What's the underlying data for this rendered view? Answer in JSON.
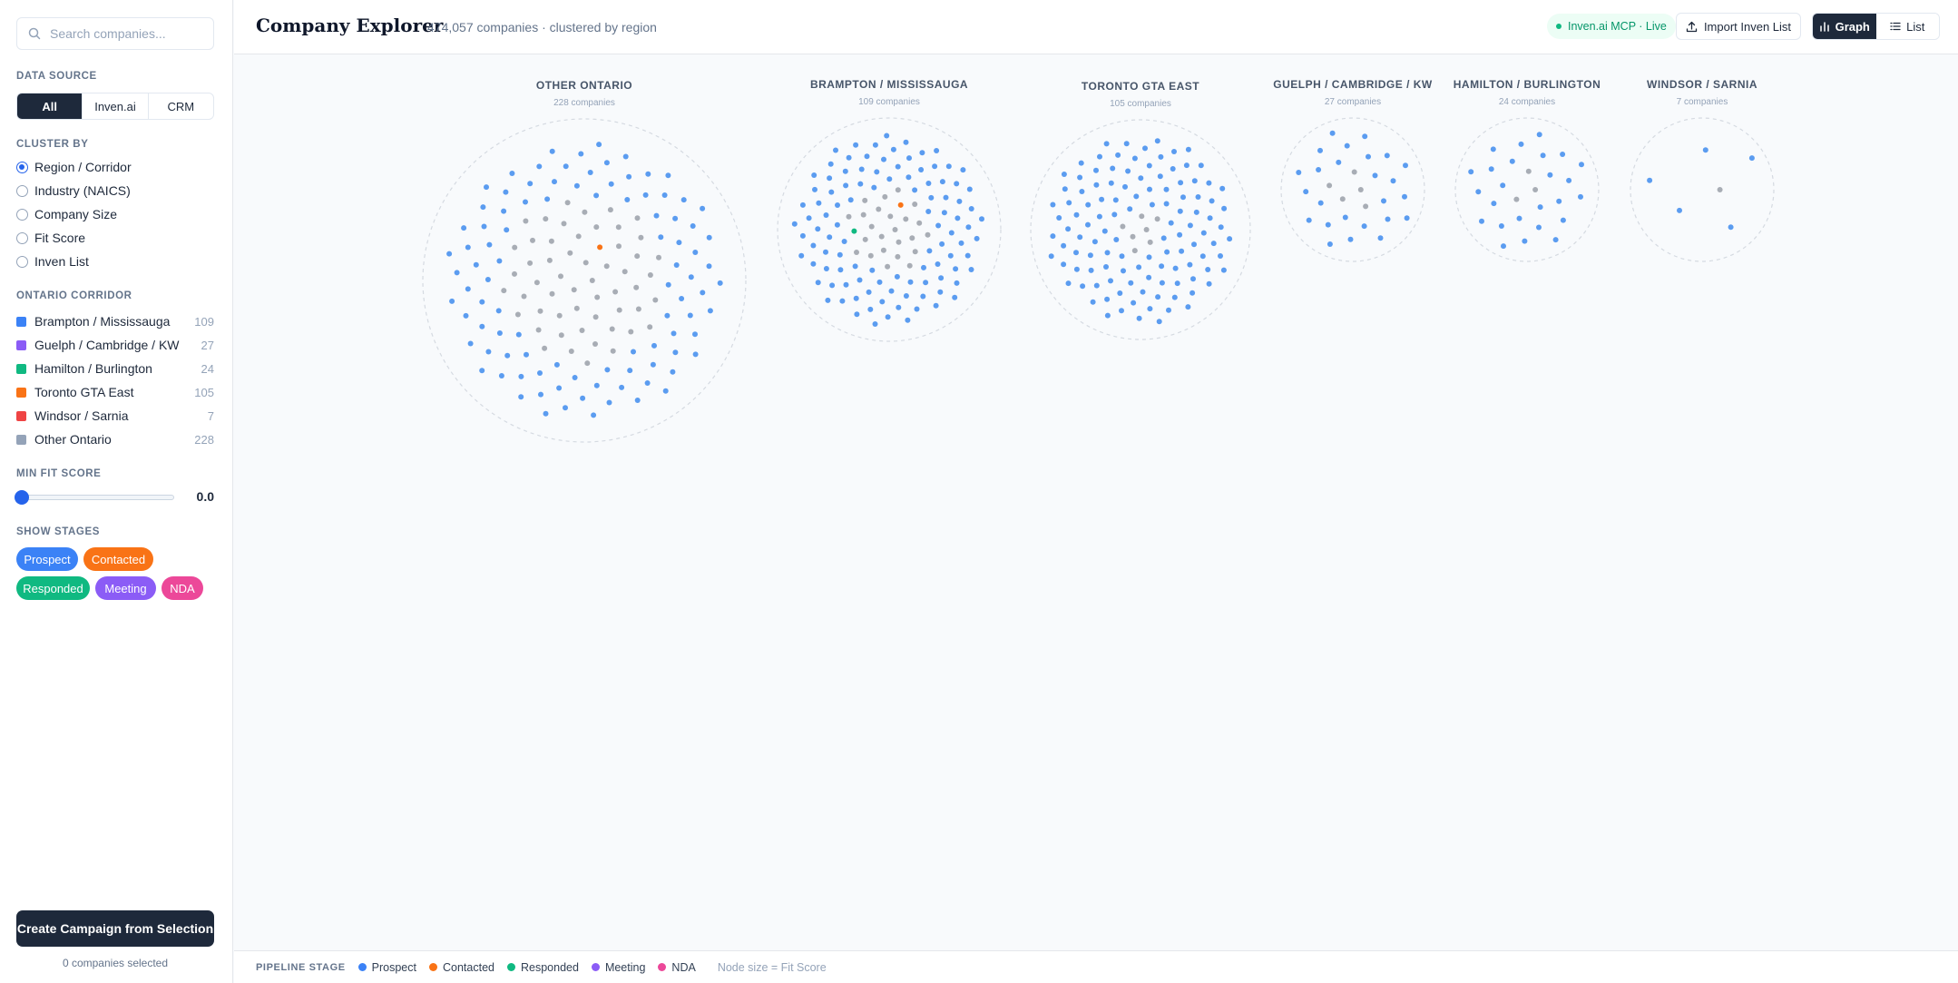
{
  "sidebar": {
    "search_placeholder": "Search companies...",
    "data_source": {
      "title": "DATA SOURCE",
      "options": [
        "All",
        "Inven.ai",
        "CRM"
      ],
      "selected": "All"
    },
    "cluster_by": {
      "title": "CLUSTER BY",
      "options": [
        "Region / Corridor",
        "Industry (NAICS)",
        "Company Size",
        "Fit Score",
        "Inven List"
      ],
      "selected": "Region / Corridor"
    },
    "corridor": {
      "title": "ONTARIO CORRIDOR",
      "items": [
        {
          "label": "Brampton / Mississauga",
          "count": "109",
          "color": "#3b82f6"
        },
        {
          "label": "Guelph / Cambridge / KW",
          "count": "27",
          "color": "#8b5cf6"
        },
        {
          "label": "Hamilton / Burlington",
          "count": "24",
          "color": "#10b981"
        },
        {
          "label": "Toronto GTA East",
          "count": "105",
          "color": "#f97316"
        },
        {
          "label": "Windsor / Sarnia",
          "count": "7",
          "color": "#ef4444"
        },
        {
          "label": "Other Ontario",
          "count": "228",
          "color": "#94a3b8"
        }
      ]
    },
    "min_fit": {
      "title": "MIN FIT SCORE",
      "value": "0.0",
      "fraction": 0.0
    },
    "stages": {
      "title": "SHOW STAGES",
      "items": [
        {
          "label": "Prospect",
          "color": "#3b82f6"
        },
        {
          "label": "Contacted",
          "color": "#f97316"
        },
        {
          "label": "Responded",
          "color": "#10b981"
        },
        {
          "label": "Meeting",
          "color": "#8b5cf6"
        },
        {
          "label": "NDA",
          "color": "#ec4899"
        }
      ]
    },
    "cta_label": "Create Campaign from Selection",
    "selected_text": "0 companies selected"
  },
  "header": {
    "title": "Company Explorer",
    "subtitle": "474,057 companies · clustered by region",
    "live_label": "Inven.ai MCP · Live",
    "import_label": "Import Inven List",
    "graph_label": "Graph",
    "list_label": "List"
  },
  "clusters": [
    {
      "name": "OTHER ONTARIO",
      "count_text": "228 companies",
      "gray": 55,
      "blue": 95,
      "orange": 1,
      "green": 0
    },
    {
      "name": "BRAMPTON / MISSISSAUGA",
      "count_text": "109 companies",
      "gray": 26,
      "blue": 103,
      "orange": 1,
      "green": 1
    },
    {
      "name": "TORONTO GTA EAST",
      "count_text": "105 companies",
      "gray": 7,
      "blue": 116,
      "orange": 0,
      "green": 0
    },
    {
      "name": "GUELPH / CAMBRIDGE / KW",
      "count_text": "27 companies",
      "gray": 5,
      "blue": 25,
      "orange": 0,
      "green": 0
    },
    {
      "name": "HAMILTON / BURLINGTON",
      "count_text": "24 companies",
      "gray": 3,
      "blue": 25,
      "orange": 0,
      "green": 0
    },
    {
      "name": "WINDSOR / SARNIA",
      "count_text": "7 companies",
      "gray": 1,
      "blue": 5,
      "orange": 0,
      "green": 0
    }
  ],
  "footer": {
    "label": "PIPELINE STAGE",
    "items": [
      {
        "label": "Prospect",
        "color": "#3b82f6"
      },
      {
        "label": "Contacted",
        "color": "#f97316"
      },
      {
        "label": "Responded",
        "color": "#10b981"
      },
      {
        "label": "Meeting",
        "color": "#8b5cf6"
      },
      {
        "label": "NDA",
        "color": "#ec4899"
      }
    ],
    "note": "Node size = Fit Score"
  },
  "colors": {
    "prospect": "#5b9cf0",
    "other": "#a8adb5",
    "contacted": "#f97316",
    "responded": "#10b981",
    "dark": "#1e293b"
  }
}
